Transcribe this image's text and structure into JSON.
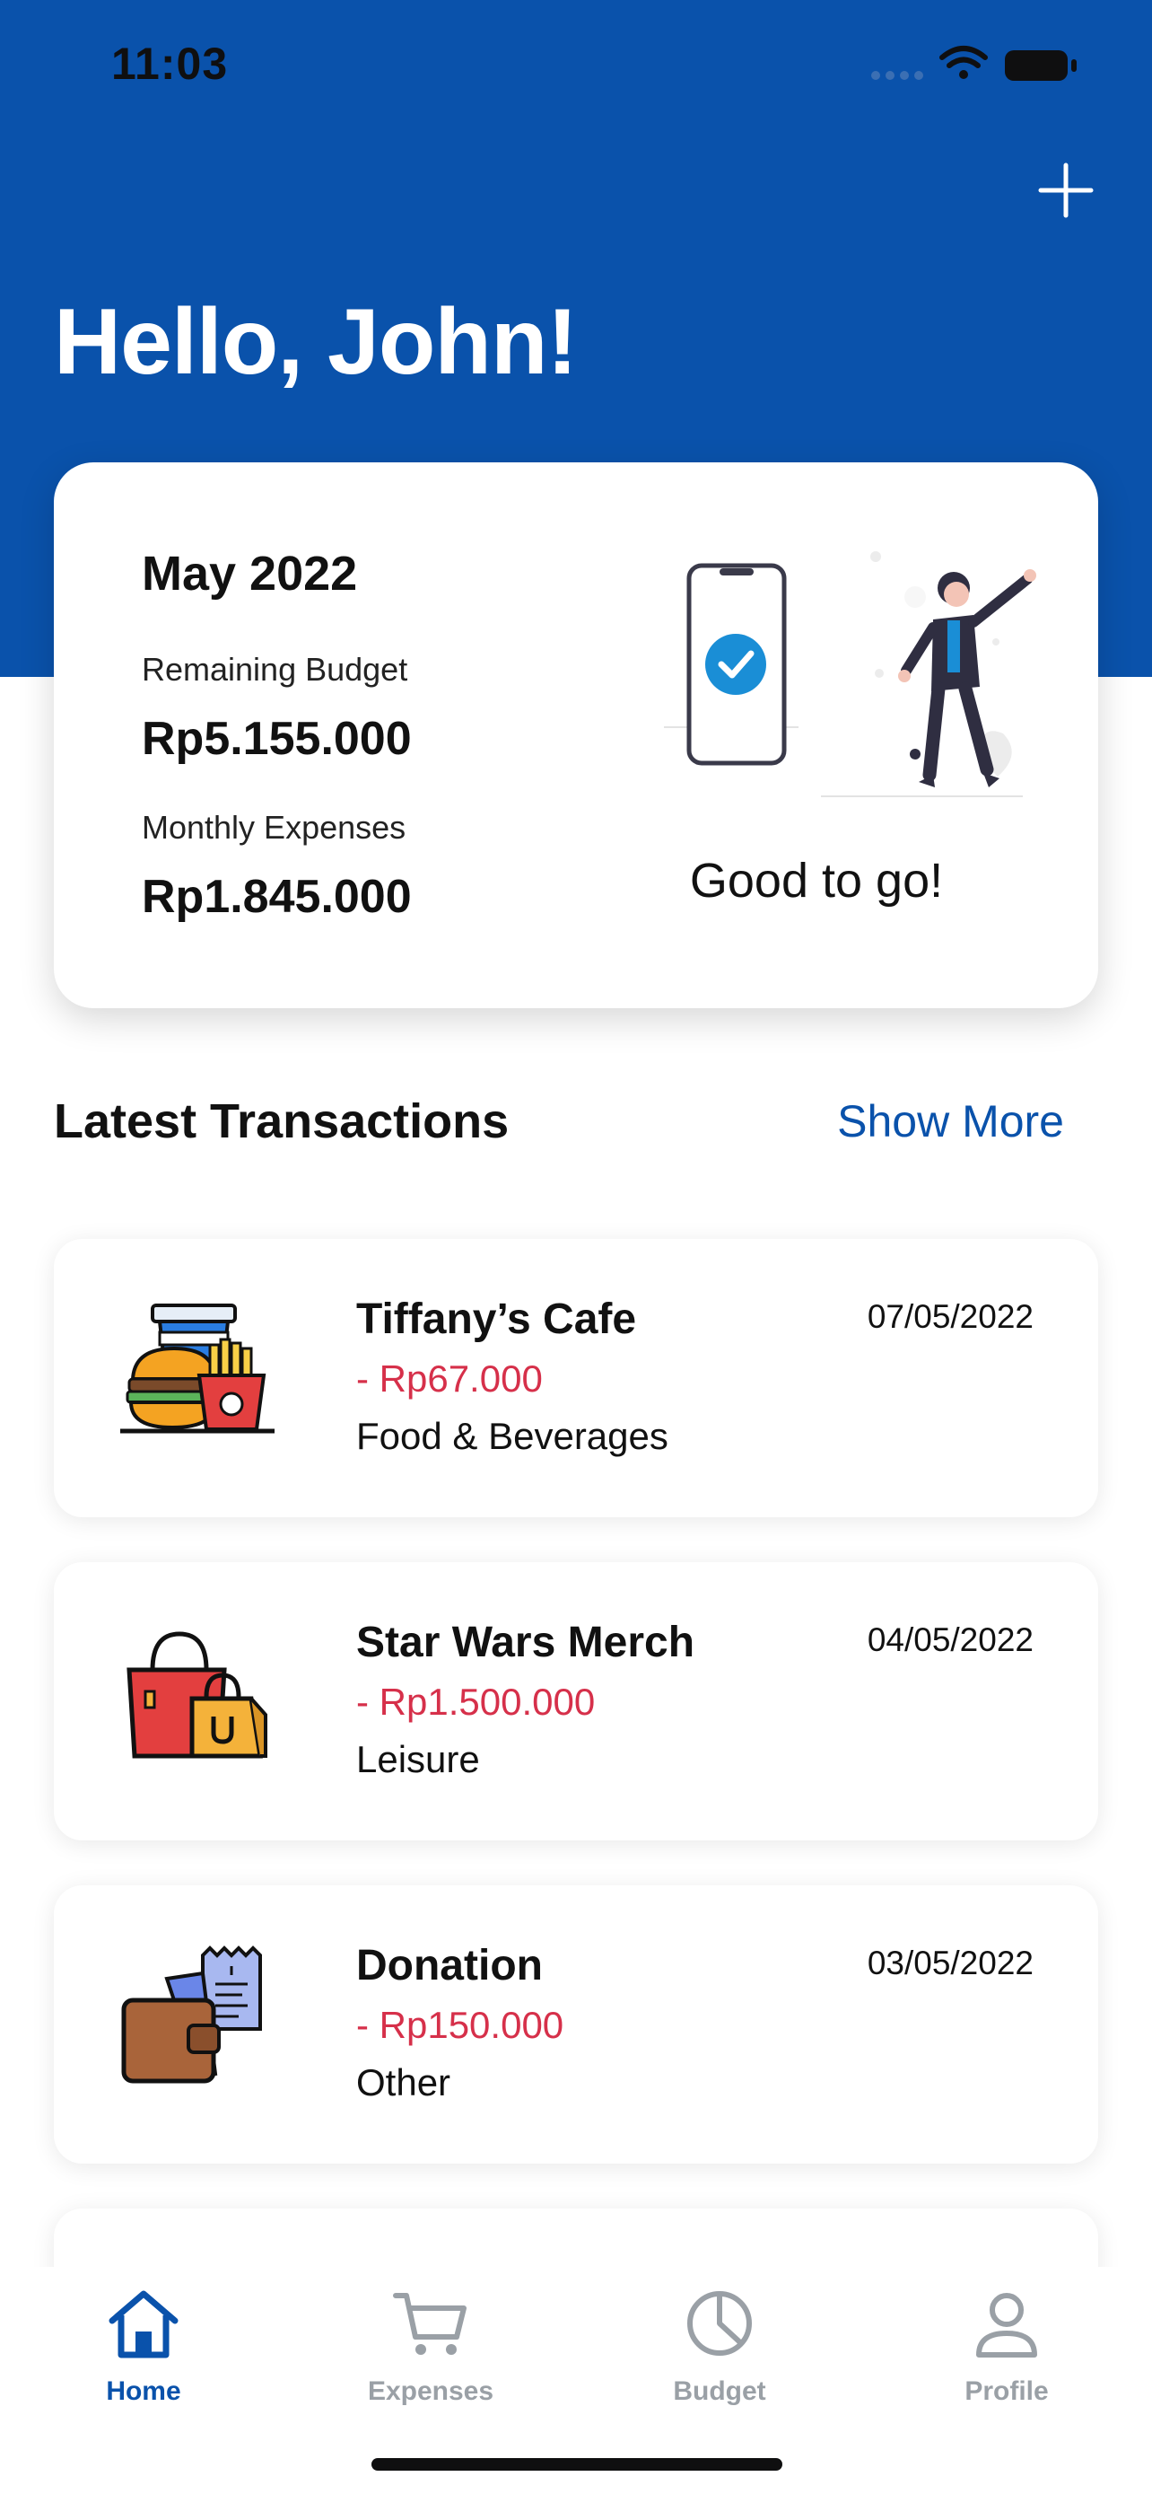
{
  "status_bar": {
    "time": "11:03"
  },
  "header": {
    "greeting": "Hello, John!"
  },
  "summary": {
    "month": "May 2022",
    "remaining_label": "Remaining Budget",
    "remaining_value": "Rp5.155.000",
    "expenses_label": "Monthly Expenses",
    "expenses_value": "Rp1.845.000",
    "status_text": "Good to go!"
  },
  "transactions": {
    "title": "Latest Transactions",
    "show_more_label": "Show More",
    "items": [
      {
        "name": "Tiffany’s Cafe",
        "amount": "- Rp67.000",
        "category": "Food & Beverages",
        "date": "07/05/2022",
        "icon": "food-icon"
      },
      {
        "name": "Star Wars Merch",
        "amount": "- Rp1.500.000",
        "category": "Leisure",
        "date": "04/05/2022",
        "icon": "shopping-bags-icon"
      },
      {
        "name": "Donation",
        "amount": "- Rp150.000",
        "category": "Other",
        "date": "03/05/2022",
        "icon": "wallet-receipt-icon"
      }
    ]
  },
  "tabs": [
    {
      "label": "Home",
      "icon": "home-icon",
      "active": true
    },
    {
      "label": "Expenses",
      "icon": "cart-icon",
      "active": false
    },
    {
      "label": "Budget",
      "icon": "pie-chart-icon",
      "active": false
    },
    {
      "label": "Profile",
      "icon": "user-icon",
      "active": false
    }
  ],
  "colors": {
    "primary": "#0a52ab",
    "expense": "#d6304a",
    "inactive": "#9aa0a6"
  }
}
